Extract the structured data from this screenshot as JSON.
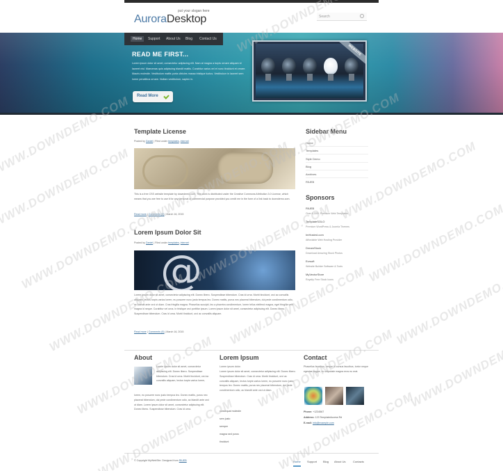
{
  "header": {
    "slogan": "put your slogan here",
    "logo_part1": "Aurora",
    "logo_part2": "Desktop",
    "search_placeholder": "Search"
  },
  "nav": {
    "items": [
      "Home",
      "Support",
      "About Us",
      "Blog",
      "Contact Us"
    ],
    "active": "Home"
  },
  "banner": {
    "title": "READ ME FIRST...",
    "text": "Lorem ipsum dolor sit amet, consectetur adipiscing elit. Nam at magna a turpis ornare aliquam id laoreet nisl. Maecenas quis adipiscing blandit mattis. Curabitur varius vel et nunc tincidunt et ornare. Mauris molestie. Vestibulum mattis porta ultricies massa tristique luctus. Vestibulum in laoreet sem lorem penatibus ornare. Nullam vestibulum, sapien in.",
    "button_label": "Read More",
    "ribbon_text": "WEBSITE"
  },
  "posts": [
    {
      "title": "Template License",
      "meta_prefix": "Posted by",
      "author": "Daniel",
      "meta_mid": "| Filed under",
      "tag1": "templates",
      "tag2": "internet",
      "text": "This is a free CSS website template by downdemo.com. This work is distributed under the Creative Commons Attribution 3.0 License, which means that you are free to use it for any personal or commercial purpose provided you credit me in the form of a link back to downdemo.com.",
      "read_more": "Read more",
      "comments": "Comments (0)",
      "date": "| March 16, 2015"
    },
    {
      "title": "Lorem Ipsum Dolor Sit",
      "meta_prefix": "Posted by",
      "author": "Daniel",
      "meta_mid": "| Filed under",
      "tag1": "templates",
      "tag2": "internet",
      "text": "Lorem ipsum dolor sit amet, consectetur adipiscing elit. Donec libero. Suspendisse bibendum. Cras id urna. Morbi tincidunt, orci ac convallis aliquam, lectus turpis varius lorem, eu posuere nunc justo tempus leo. Donec mattis, purus nec placerat bibendum, dui pede condimentum odio, ac blandit ante orci ut diam. Cras fringilla magna. Phasellus suscipit, leo a pharetra condimentum, lorem tellus eleifend magna, eget fringilla velit magna id neque. Curabitur vel urna. In tristique orci porttitor ipsum. Lorem ipsum dolor sit amet, consectetur adipiscing elit. Donec libero. Suspendisse bibendum. Cras id urna. Morbi tincidunt, orci ac convallis aliquam.",
      "read_more": "Read more",
      "comments": "Comments (0)",
      "date": "| March 16, 2015"
    }
  ],
  "sidebar": {
    "menu_title": "Sidebar Menu",
    "menu_items": [
      "Home",
      "Templates",
      "Style Demo",
      "Blog",
      "Archives",
      "RIUEB"
    ],
    "sponsors_title": "Sponsors",
    "sponsors": [
      {
        "name": "RIUEB",
        "desc": "Over 6,000+ Premium Web Templates"
      },
      {
        "name": "TemplateSOLO",
        "desc": "Premium WordPress & Joomla Themes"
      },
      {
        "name": "ImHosted.com",
        "desc": "Affordable Web Hosting Provider"
      },
      {
        "name": "DreamStock",
        "desc": "Download Amazing Stock Photos"
      },
      {
        "name": "Evrsoft",
        "desc": "Website Builder Software & Tools"
      },
      {
        "name": "MyVectorStore",
        "desc": "Royalty Free Stock Icons"
      }
    ]
  },
  "footer": {
    "about_title": "About",
    "about_text_side": "Lorem ipsum dolor sit amet, consectetur adipiscing elit. Donec libero. Suspendisse bibendum. Cras id urna. Morbi tincidunt, orci ac convallis aliquam, lectus turpis varius lorem,",
    "about_text_full": "lorem, eu posuere nunc justo tempus leo. Donec mattis, purus nec placerat bibendum, dui pede condimentum odio, ac blandit ante orci ut diam. Lorem ipsum dolor sit amet, consectetur adipiscing elit. Donec libero. Suspendisse bibendum. Cras id urna.",
    "lorem_title": "Lorem Ipsum",
    "lorem_text1": "Lorem ipsum dolor.",
    "lorem_text2": "Lorem ipsum dolor sit amet, consectetur adipiscing elit. Donec libero. Suspendisse bibendum. Cras id urna. Morbi tincidunt, orci ac convallis aliquam, lectus turpis varius lorem, eu posuere nunc justo tempus leo. Donec mattis, purus nec placerat bibendum, dui pede condimentum odio, ac blandit ante orci ut diam.",
    "lorem_links": [
      "consequat molestie",
      "sem justo",
      "semper",
      "magna sed purus",
      "tincidunt"
    ],
    "contact_title": "Contact",
    "contact_text": "Phasellus faucibus, neque id cursus faucibus, tortor neque egestas augue, eu vulputate magna eros eu erat.",
    "phone_label": "Phone:",
    "phone": "+1234567",
    "address_label": "Address:",
    "address": "123 TemplateAccess Rd",
    "email_label": "E-mail:",
    "email": "info@example.com",
    "copyright_text": "© Copyright MyWebSite. Designed from",
    "copyright_link": "RIUEB",
    "nav": [
      "Home",
      "Support",
      "Blog",
      "About Us",
      "Contacts"
    ],
    "nav_active": "Home"
  },
  "watermark": "WWW.DOWNDEMO.COM",
  "colors": {
    "accent": "#3a6f9b",
    "nav_bg": "#2e3338",
    "check_green": "#7bb62b"
  }
}
